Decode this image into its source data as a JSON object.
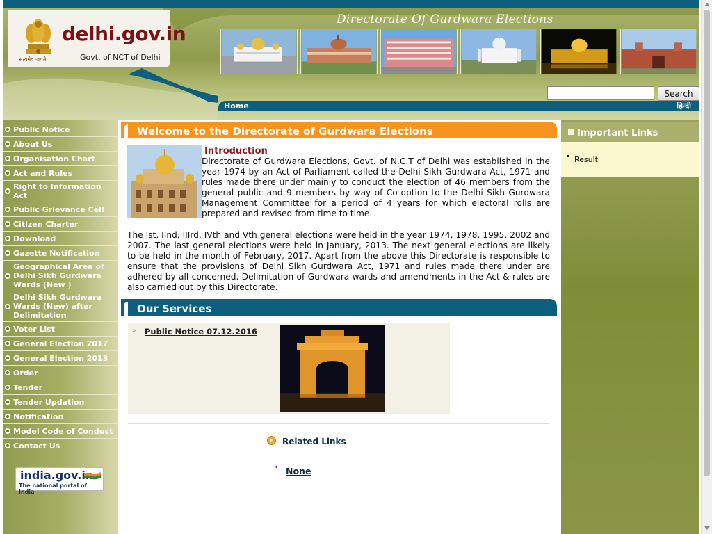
{
  "header": {
    "site_name": "delhi.gov.in",
    "site_subtitle": "Govt. of NCT of Delhi",
    "emblem_motto": "सत्यमेव जयते",
    "department_title": "Directorate Of Gurdwara Elections",
    "search_placeholder": "",
    "search_button": "Search",
    "nav_home": "Home",
    "nav_hindi": "हिन्दी"
  },
  "sidebar": {
    "items": [
      {
        "label": "Public Notice"
      },
      {
        "label": "About Us"
      },
      {
        "label": "Organisation Chart"
      },
      {
        "label": "Act and Rules"
      },
      {
        "label": "Right to Information Act"
      },
      {
        "label": "Public Grievance Cell"
      },
      {
        "label": "Citizen Charter"
      },
      {
        "label": "Download"
      },
      {
        "label": "Gazette Notification"
      },
      {
        "label": "Geographical Area of Delhi Sikh Gurdwara Wards (New )"
      },
      {
        "label": "Delhi Sikh Gurdwara Wards (New) after Delimitation"
      },
      {
        "label": "Voter List"
      },
      {
        "label": "General Election 2017"
      },
      {
        "label": "General Election 2013"
      },
      {
        "label": "Order"
      },
      {
        "label": "Tender"
      },
      {
        "label": "Tender Updation"
      },
      {
        "label": "Notification"
      },
      {
        "label": "Model Code of Conduct"
      },
      {
        "label": "Contact Us"
      }
    ],
    "portal_name": "india.gov.in",
    "portal_tagline": "The national portal of India"
  },
  "main": {
    "welcome_heading": "Welcome to the Directorate of Gurdwara Elections",
    "intro_title": "Introduction",
    "intro_text": "Directorate of Gurdwara Elections, Govt. of N.C.T of Delhi was established in  the year 1974 by an Act of Parliament called the Delhi Sikh Gurdwara Act, 1971  and rules made there under mainly to conduct the election of 46 members  from the general public and 9 members by way of Co-option to the Delhi Sikh  Gurdwara Management Committee for a period of 4 years for which electoral  rolls are prepared and revised from time to time.",
    "history_text": "The Ist, IInd, IIIrd, IVth and Vth general elections were held in the year 1974, 1978, 1995, 2002 and 2007. The last general elections were held in January, 2013. The next general elections are likely to be held in the month of February, 2017. Apart from the above this Directorate is responsible to ensure that the provisions of Delhi Sikh Gurdwara Act, 1971 and rules made there under are adhered by all concerned. Delimitation of Gurdwara wards and amendments in the Act & rules are also carried out by this Directorate.",
    "services_heading": "Our Services",
    "service_link": "Public Notice 07.12.2016",
    "related_title": "Related Links",
    "related_none": "None"
  },
  "right": {
    "important_links_title": "Important Links",
    "links": [
      {
        "label": "Result"
      }
    ]
  },
  "colors": {
    "teal": "#0e5f7e",
    "orange": "#f7941d",
    "olive": "#8f9b4d",
    "maroon": "#7a1414"
  },
  "icons": [
    "emblem-icon",
    "bullet-icon",
    "arrow-icon",
    "square-icon",
    "related-links-icon",
    "flag-icon"
  ]
}
